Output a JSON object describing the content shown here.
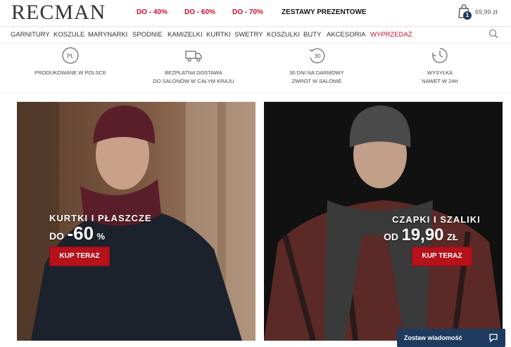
{
  "header": {
    "logo": "RECMAN",
    "promos": [
      "DO - 40%",
      "DO - 60%",
      "DO - 70%",
      "ZESTAWY PREZENTOWE"
    ],
    "cart": {
      "count": "1",
      "amount": "69,99 zł"
    }
  },
  "nav": {
    "items": [
      "GARNITURY",
      "KOSZULE",
      "MARYNARKI",
      "SPODNIE",
      "KAMIZELKI",
      "KURTKI",
      "SWETRY",
      "KOSZULKI",
      "BUTY",
      "AKCESORIA",
      "WYPRZEDAŻ"
    ]
  },
  "benefits": [
    {
      "icon": "pl-badge-icon",
      "line1": "PRODUKOWANE W POLSCE",
      "line2": ""
    },
    {
      "icon": "delivery-truck-icon",
      "line1": "BEZPŁATNA DOSTAWA",
      "line2": "DO SALONÓW W CAŁYM KRAJU"
    },
    {
      "icon": "return-30-icon",
      "line1": "30 DNI NA DARMOWY",
      "line2": "ZWROT W SALONIE"
    },
    {
      "icon": "stopwatch-icon",
      "line1": "WYSYŁKA",
      "line2": "NAWET W 24H"
    }
  ],
  "banners": [
    {
      "title": "KURTKI I PŁASZCZE",
      "price_prefix": "DO",
      "price": "-60",
      "price_suffix": "%",
      "cta": "KUP TERAZ"
    },
    {
      "title": "CZAPKI I SZALIKI",
      "price_prefix": "OD",
      "price": "19,90",
      "price_suffix": "ZŁ",
      "cta": "KUP TERAZ"
    }
  ],
  "chat": {
    "label": "Zostaw wiadomość"
  }
}
